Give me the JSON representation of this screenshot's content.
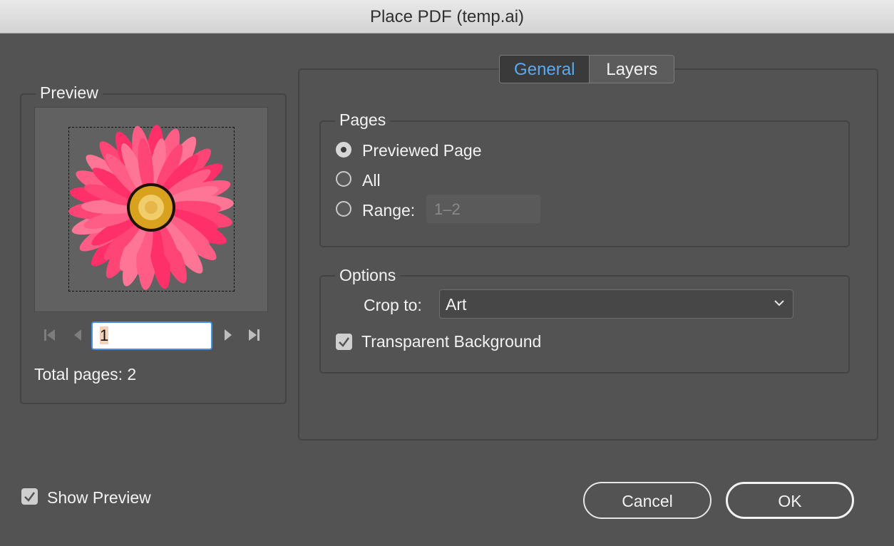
{
  "window": {
    "title": "Place PDF (temp.ai)"
  },
  "preview": {
    "title": "Preview",
    "page_value": "1",
    "total_pages_label": "Total pages: 2"
  },
  "tabs": [
    {
      "label": "General",
      "active": true
    },
    {
      "label": "Layers",
      "active": false
    }
  ],
  "pages": {
    "title": "Pages",
    "options": [
      "Previewed Page",
      "All",
      "Range:"
    ],
    "selected": "Previewed Page",
    "range_placeholder": "1–2"
  },
  "options": {
    "title": "Options",
    "crop_label": "Crop to:",
    "crop_value": "Art",
    "transparent_background_label": "Transparent Background",
    "transparent_background_checked": true
  },
  "footer": {
    "show_preview_label": "Show Preview",
    "show_preview_checked": true,
    "cancel_label": "Cancel",
    "ok_label": "OK"
  },
  "colors": {
    "accent_tab_text": "#5aa9f2",
    "focus_ring": "#4a8fe0",
    "petal": "#ff4f7e",
    "flower_center": "#d9a21e"
  }
}
